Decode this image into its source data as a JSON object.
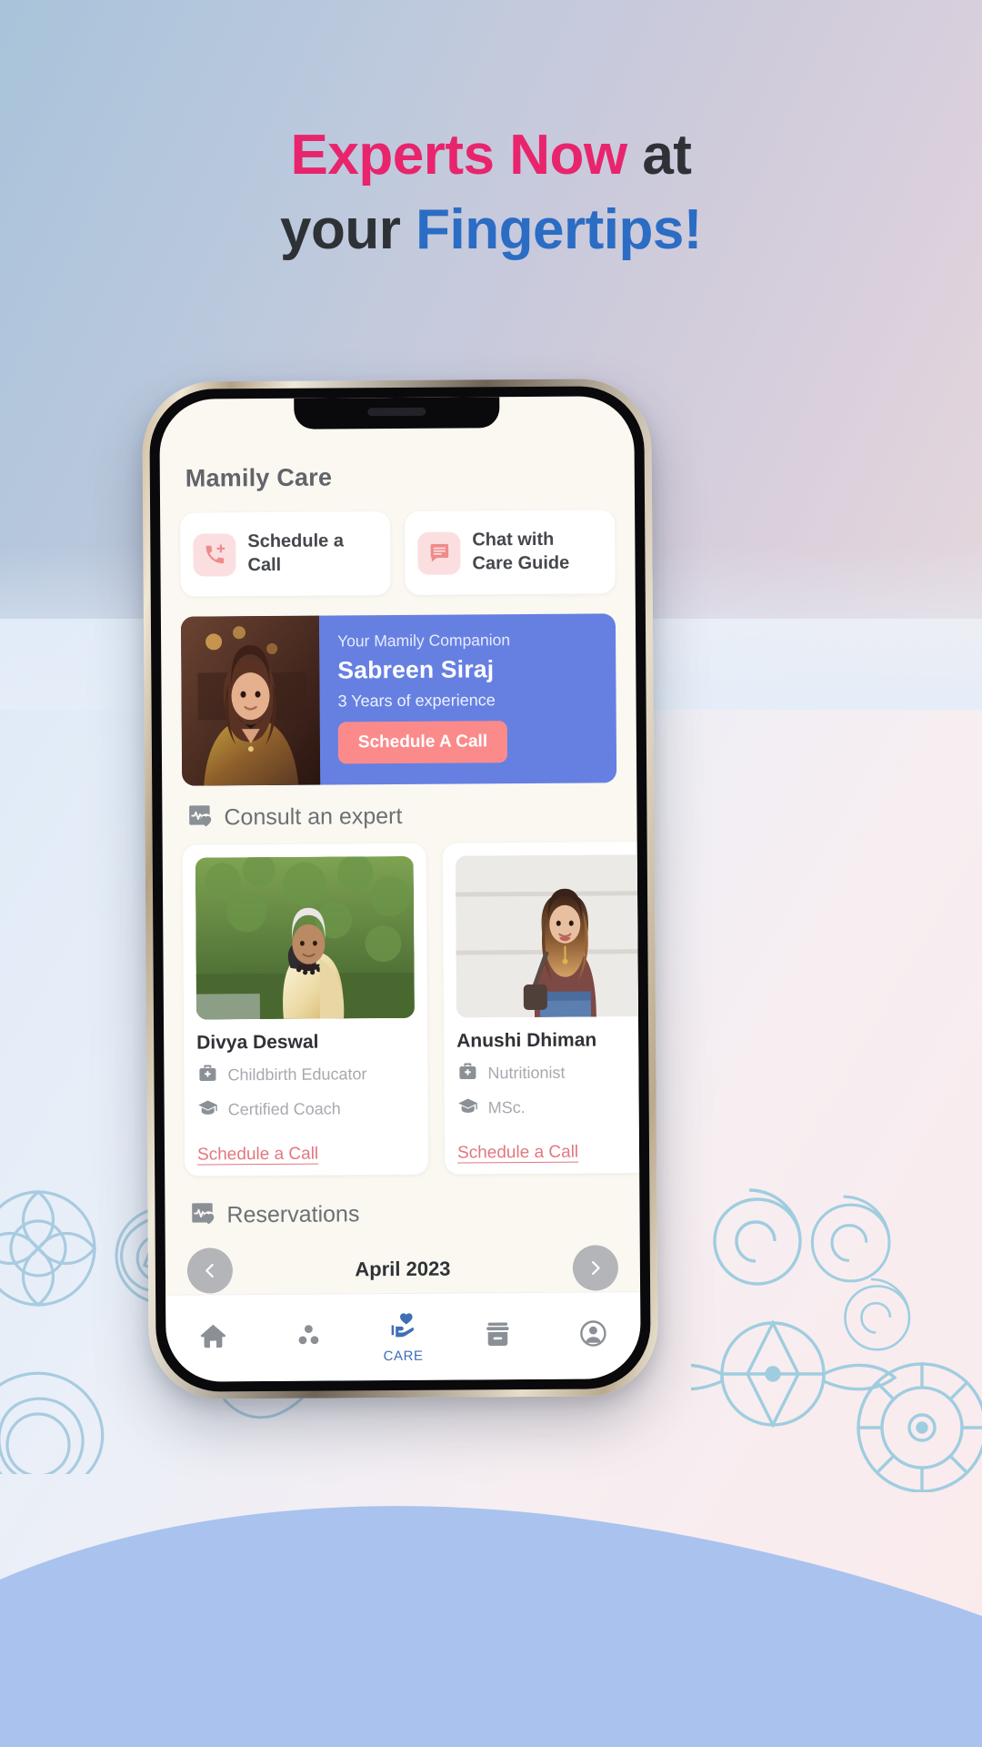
{
  "headline": {
    "line1_a": "Experts Now",
    "line1_b": " at",
    "line2_a": "your ",
    "line2_b": "Fingertips!"
  },
  "colors": {
    "pink": "#e8246d",
    "blue": "#2b6cc4",
    "dark": "#2e3236",
    "companion_card": "#6680e2",
    "cta": "#fb8b8b",
    "link": "#e2777f",
    "wave": "#a9c3ee"
  },
  "app": {
    "title": "Mamily Care",
    "quick_actions": [
      {
        "label": "Schedule a\nCall",
        "label_line1": "Schedule a",
        "label_line2": "Call",
        "icon": "phone-plus-icon"
      },
      {
        "label": "Chat with\nCare Guide",
        "label_line1": "Chat with",
        "label_line2": "Care Guide",
        "icon": "chat-bubble-icon"
      }
    ],
    "companion": {
      "subtitle": "Your Mamily Companion",
      "name": "Sabreen Siraj",
      "experience": "3 Years of experience",
      "cta": "Schedule A Call"
    },
    "consult": {
      "section_title": "Consult an expert",
      "section_icon": "pulse-heart-icon",
      "experts": [
        {
          "name": "Divya Deswal",
          "credential_1": "Childbirth Educator",
          "credential_1_icon": "medical-bag-icon",
          "credential_2": "Certified Coach",
          "credential_2_icon": "graduation-cap-icon",
          "link": "Schedule a Call"
        },
        {
          "name": "Anushi Dhiman",
          "credential_1": "Nutritionist",
          "credential_1_icon": "medical-bag-icon",
          "credential_2": "MSc.",
          "credential_2_icon": "graduation-cap-icon",
          "link": "Schedule a Call"
        }
      ]
    },
    "reservations": {
      "section_title": "Reservations",
      "section_icon": "pulse-heart-icon",
      "prev_icon": "chevron-left-icon",
      "next_icon": "chevron-right-icon",
      "month": "April 2023"
    },
    "tabbar": {
      "items": [
        {
          "icon": "home-icon",
          "label": "",
          "active": false
        },
        {
          "icon": "dots-cluster-icon",
          "label": "",
          "active": false
        },
        {
          "icon": "hand-heart-icon",
          "label": "CARE",
          "active": true
        },
        {
          "icon": "archive-box-icon",
          "label": "",
          "active": false
        },
        {
          "icon": "account-circle-icon",
          "label": "",
          "active": false
        }
      ]
    }
  }
}
